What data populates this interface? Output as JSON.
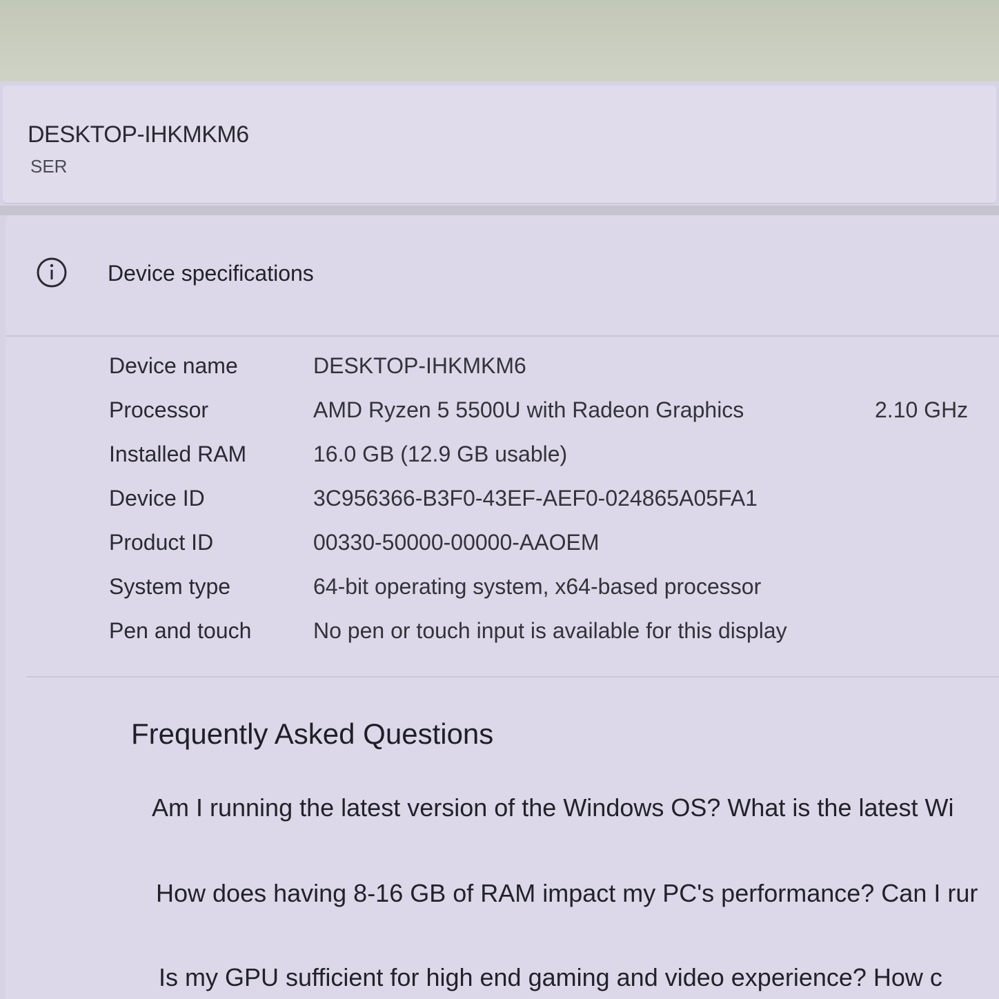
{
  "header": {
    "device_title": "DESKTOP-IHKMKM6",
    "device_subtitle": "SER"
  },
  "specs": {
    "section_title": "Device specifications",
    "section_icon": "info-icon",
    "rows": [
      {
        "label": "Device name",
        "value": "DESKTOP-IHKMKM6",
        "extra": ""
      },
      {
        "label": "Processor",
        "value": "AMD Ryzen 5 5500U with Radeon Graphics",
        "extra": "2.10 GHz"
      },
      {
        "label": "Installed RAM",
        "value": "16.0 GB (12.9 GB usable)",
        "extra": ""
      },
      {
        "label": "Device ID",
        "value": "3C956366-B3F0-43EF-AEF0-024865A05FA1",
        "extra": ""
      },
      {
        "label": "Product ID",
        "value": "00330-50000-00000-AAOEM",
        "extra": ""
      },
      {
        "label": "System type",
        "value": "64-bit operating system, x64-based processor",
        "extra": ""
      },
      {
        "label": "Pen and touch",
        "value": "No pen or touch input is available for this display",
        "extra": ""
      }
    ]
  },
  "faq": {
    "title": "Frequently Asked Questions",
    "items": [
      "Am I running the latest version of the Windows OS? What is the latest Wi",
      "How does having 8-16 GB of RAM impact my PC's performance? Can I rur",
      "Is my GPU sufficient for high end gaming and video experience? How c"
    ]
  },
  "colors": {
    "window_bg": "#d7d3e6",
    "card_bg": "#dcd8ea",
    "text_primary": "#2a2a30"
  }
}
